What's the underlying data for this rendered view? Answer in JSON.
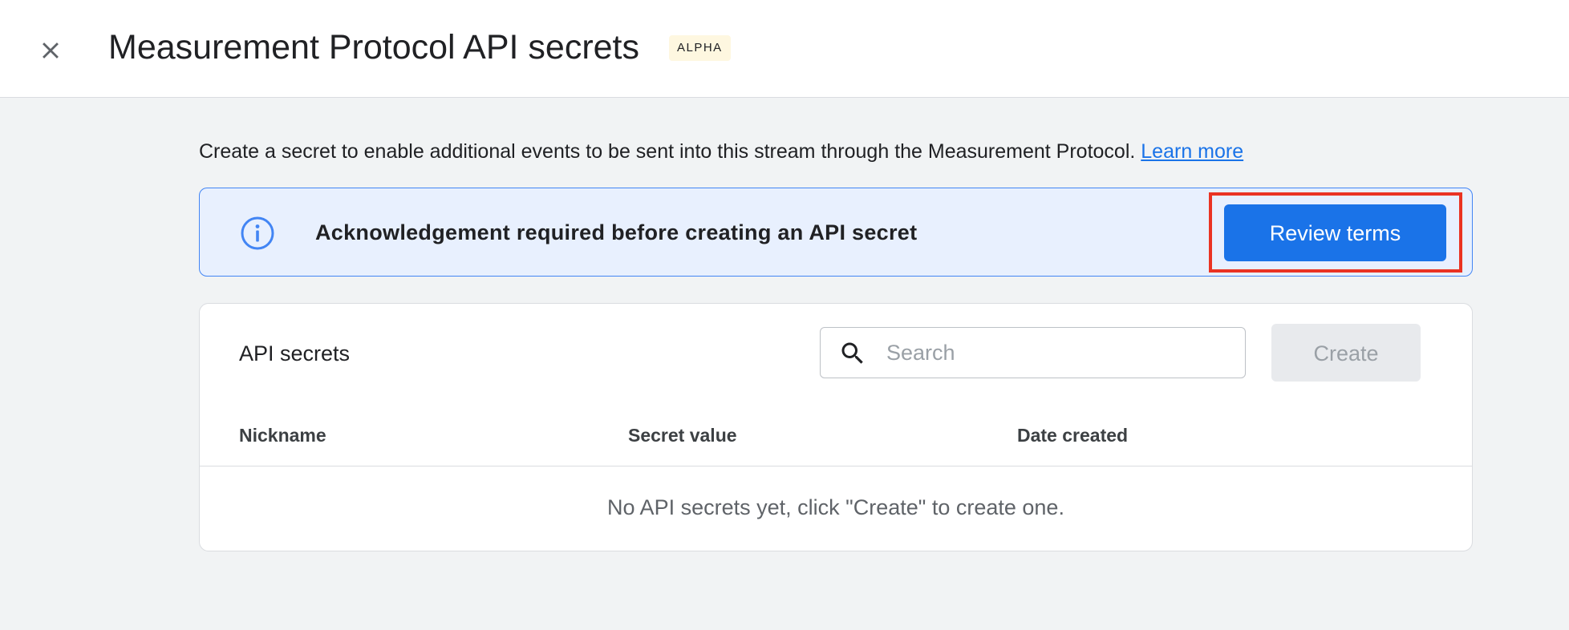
{
  "header": {
    "title": "Measurement Protocol API secrets",
    "badge": "ALPHA",
    "close_icon": "close-icon"
  },
  "intro": {
    "text": "Create a secret to enable additional events to be sent into this stream through the Measurement Protocol. ",
    "link_label": "Learn more"
  },
  "banner": {
    "icon": "info-icon",
    "message": "Acknowledgement required before creating an API secret",
    "button_label": "Review terms"
  },
  "secrets_card": {
    "title": "API secrets",
    "search": {
      "icon": "search-icon",
      "placeholder": "Search",
      "value": ""
    },
    "create_label": "Create",
    "columns": [
      "Nickname",
      "Secret value",
      "Date created"
    ],
    "rows": [],
    "empty_message": "No API secrets yet, click \"Create\" to create one."
  },
  "colors": {
    "accent": "#1a73e8",
    "banner_bg": "#e8f0fe",
    "banner_border": "#4285f4",
    "highlight": "#ea3323",
    "page_bg": "#f1f3f4",
    "badge_bg": "#fef7e0"
  }
}
